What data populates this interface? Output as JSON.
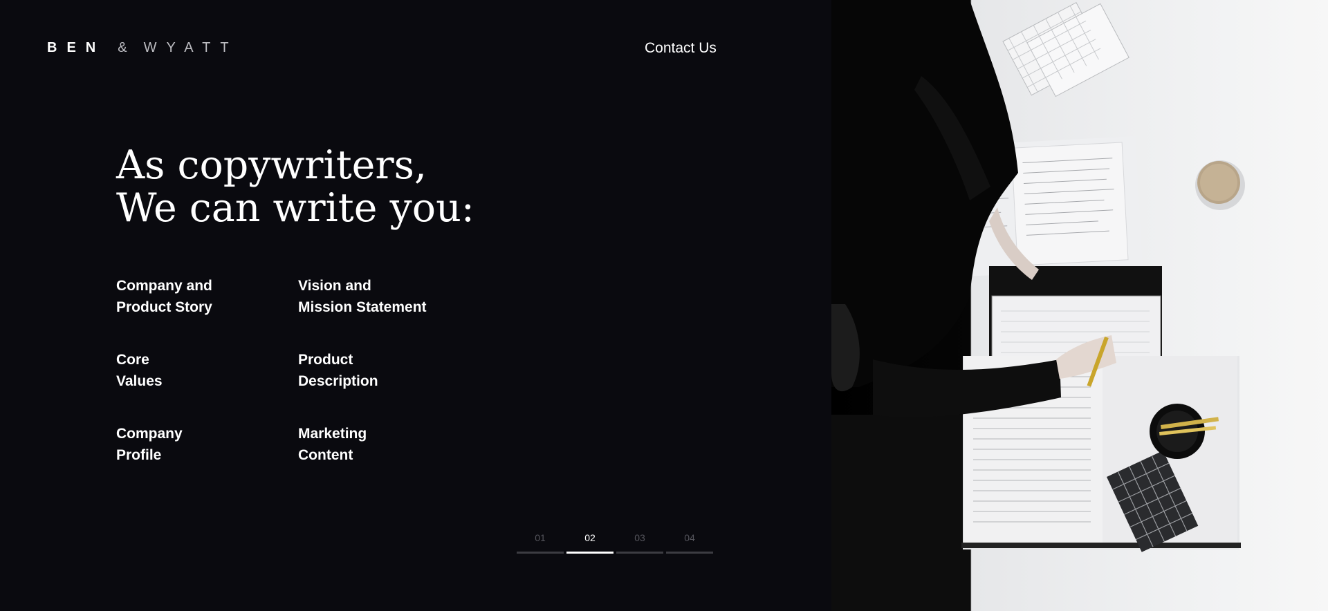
{
  "brand": {
    "part1": "BEN",
    "amp": "&",
    "part2": "WYATT"
  },
  "nav": {
    "contact": "Contact Us"
  },
  "headline": {
    "line1": "As copywriters,",
    "line2": "We can write you:"
  },
  "services": [
    {
      "line1": "Company and",
      "line2": "Product Story"
    },
    {
      "line1": "Vision and",
      "line2": "Mission Statement"
    },
    {
      "line1": "Core",
      "line2": "Values"
    },
    {
      "line1": "Product",
      "line2": "Description"
    },
    {
      "line1": "Company",
      "line2": "Profile"
    },
    {
      "line1": "Marketing",
      "line2": "Content"
    }
  ],
  "pager": {
    "pages": [
      "01",
      "02",
      "03",
      "04"
    ],
    "active_index": 1
  },
  "colors": {
    "background": "#0a0a0f",
    "text": "#ffffff",
    "muted": "#55555c"
  }
}
